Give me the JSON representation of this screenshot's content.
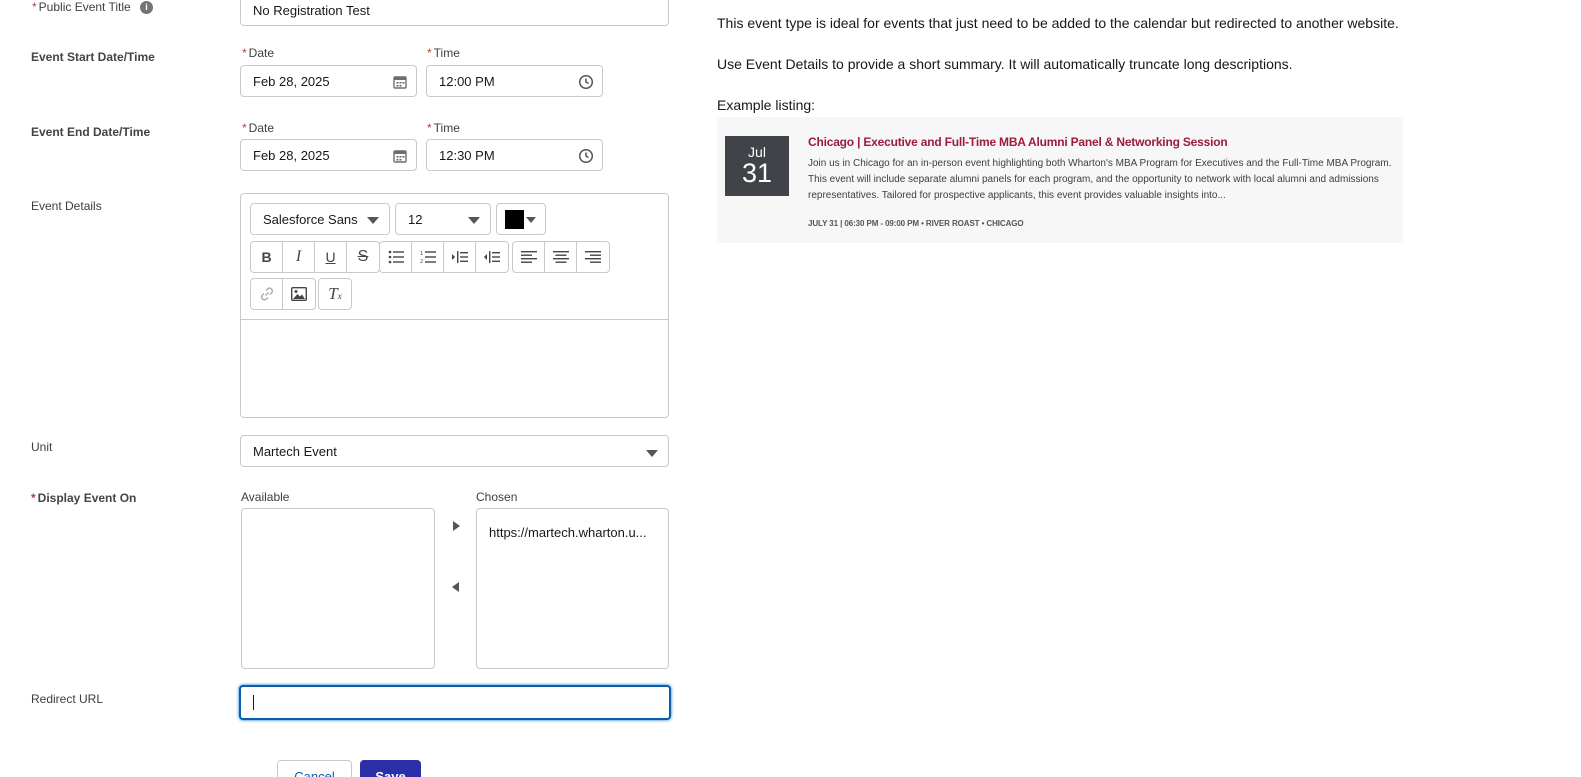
{
  "form": {
    "public_title": {
      "label": "Public Event Title",
      "value": "No Registration Test"
    },
    "start": {
      "label": "Event Start Date/Time",
      "date_label": "Date",
      "date_value": "Feb 28, 2025",
      "time_label": "Time",
      "time_value": "12:00 PM"
    },
    "end": {
      "label": "Event End Date/Time",
      "date_label": "Date",
      "date_value": "Feb 28, 2025",
      "time_label": "Time",
      "time_value": "12:30 PM"
    },
    "details": {
      "label": "Event Details",
      "font_family": "Salesforce Sans",
      "font_size": "12",
      "text_color": "#000000"
    },
    "unit": {
      "label": "Unit",
      "value": "Martech Event"
    },
    "display_on": {
      "label": "Display Event On",
      "available_label": "Available",
      "chosen_label": "Chosen",
      "available_items": [],
      "chosen_items": [
        "https://martech.wharton.u..."
      ]
    },
    "redirect": {
      "label": "Redirect URL",
      "value": ""
    },
    "buttons": {
      "cancel": "Cancel",
      "save": "Save"
    }
  },
  "info": {
    "line1": "This event type is ideal for events that just need to be added to the calendar but redirected to another website.",
    "line2": "Use Event Details to provide a short summary. It will automatically truncate long descriptions.",
    "example_label": "Example listing:",
    "listing": {
      "month": "Jul",
      "day": "31",
      "title": "Chicago | Executive and Full-Time MBA Alumni Panel & Networking Session",
      "description": "Join us in Chicago for an in-person event highlighting both Wharton's MBA Program for Executives and the Full-Time MBA Program. This event will include separate alumni panels for each program, and the opportunity to network with local alumni and admissions representatives. Tailored for prospective applicants, this event provides valuable insights into...",
      "meta": "July 31 | 06:30 PM - 09:00 PM • River Roast • Chicago"
    }
  },
  "colors": {
    "brand": "#2b2fa8",
    "required": "#c23934",
    "listing_title": "#9c1c3d",
    "date_badge": "#404347"
  }
}
